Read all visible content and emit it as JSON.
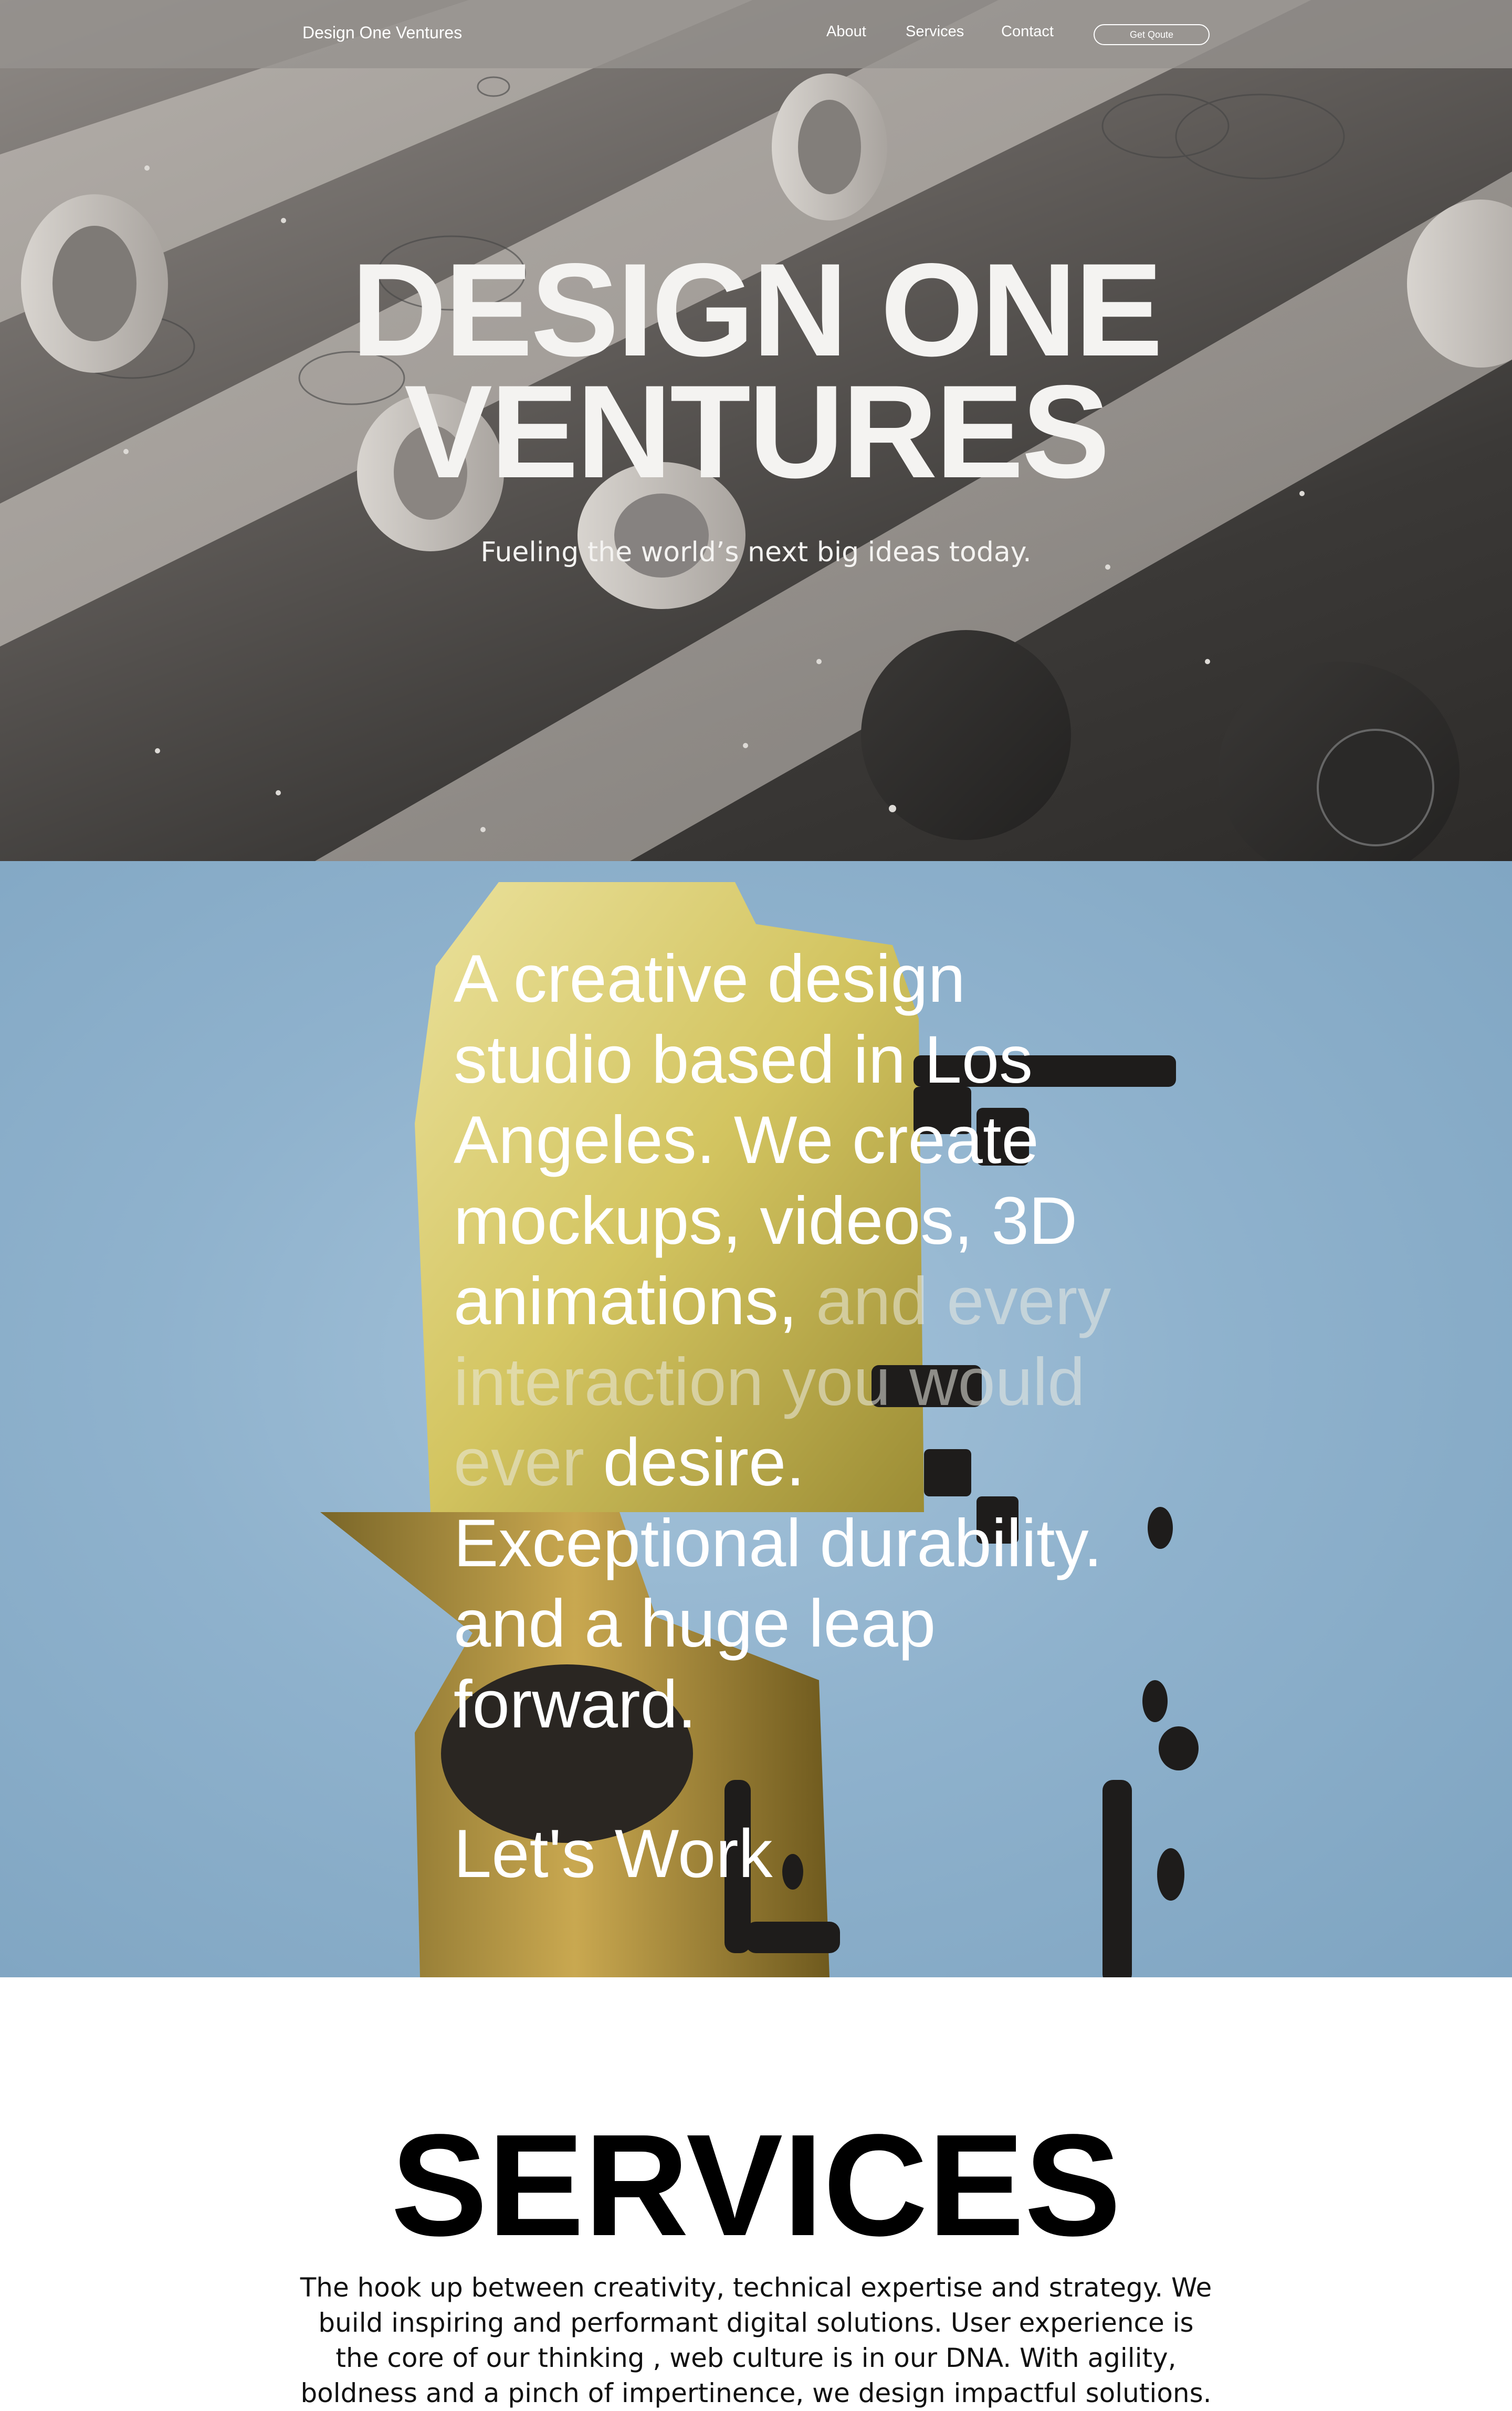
{
  "nav": {
    "brand": "Design One Ventures",
    "links": [
      "About",
      "Services",
      "Contact"
    ],
    "quote_button": "Get Qoute"
  },
  "hero": {
    "title_line1": "DESIGN ONE",
    "title_line2": "VENTURES",
    "subtitle": "Fueling the world’s next big ideas today."
  },
  "about": {
    "text_part1": "A creative design studio based in Los Angeles. We create mockups, videos, 3D animations,",
    "text_faded": "and every interaction you would ever",
    "text_part2": "desire. Exceptional durability. and a huge leap forward.",
    "cta": "Let's Work"
  },
  "services": {
    "title": "SERVICES",
    "description": "The hook up between creativity, technical expertise and strategy. We build inspiring and performant digital solutions. User experience is the core of our thinking , web culture is in our DNA. With agility, boldness and a pinch of impertinence, we design impactful solutions."
  },
  "colors": {
    "hero_bg": "#3b3937",
    "about_bg": "#8fb2cd",
    "accent_gold": "#d9c95a",
    "text_light": "#ffffff"
  }
}
